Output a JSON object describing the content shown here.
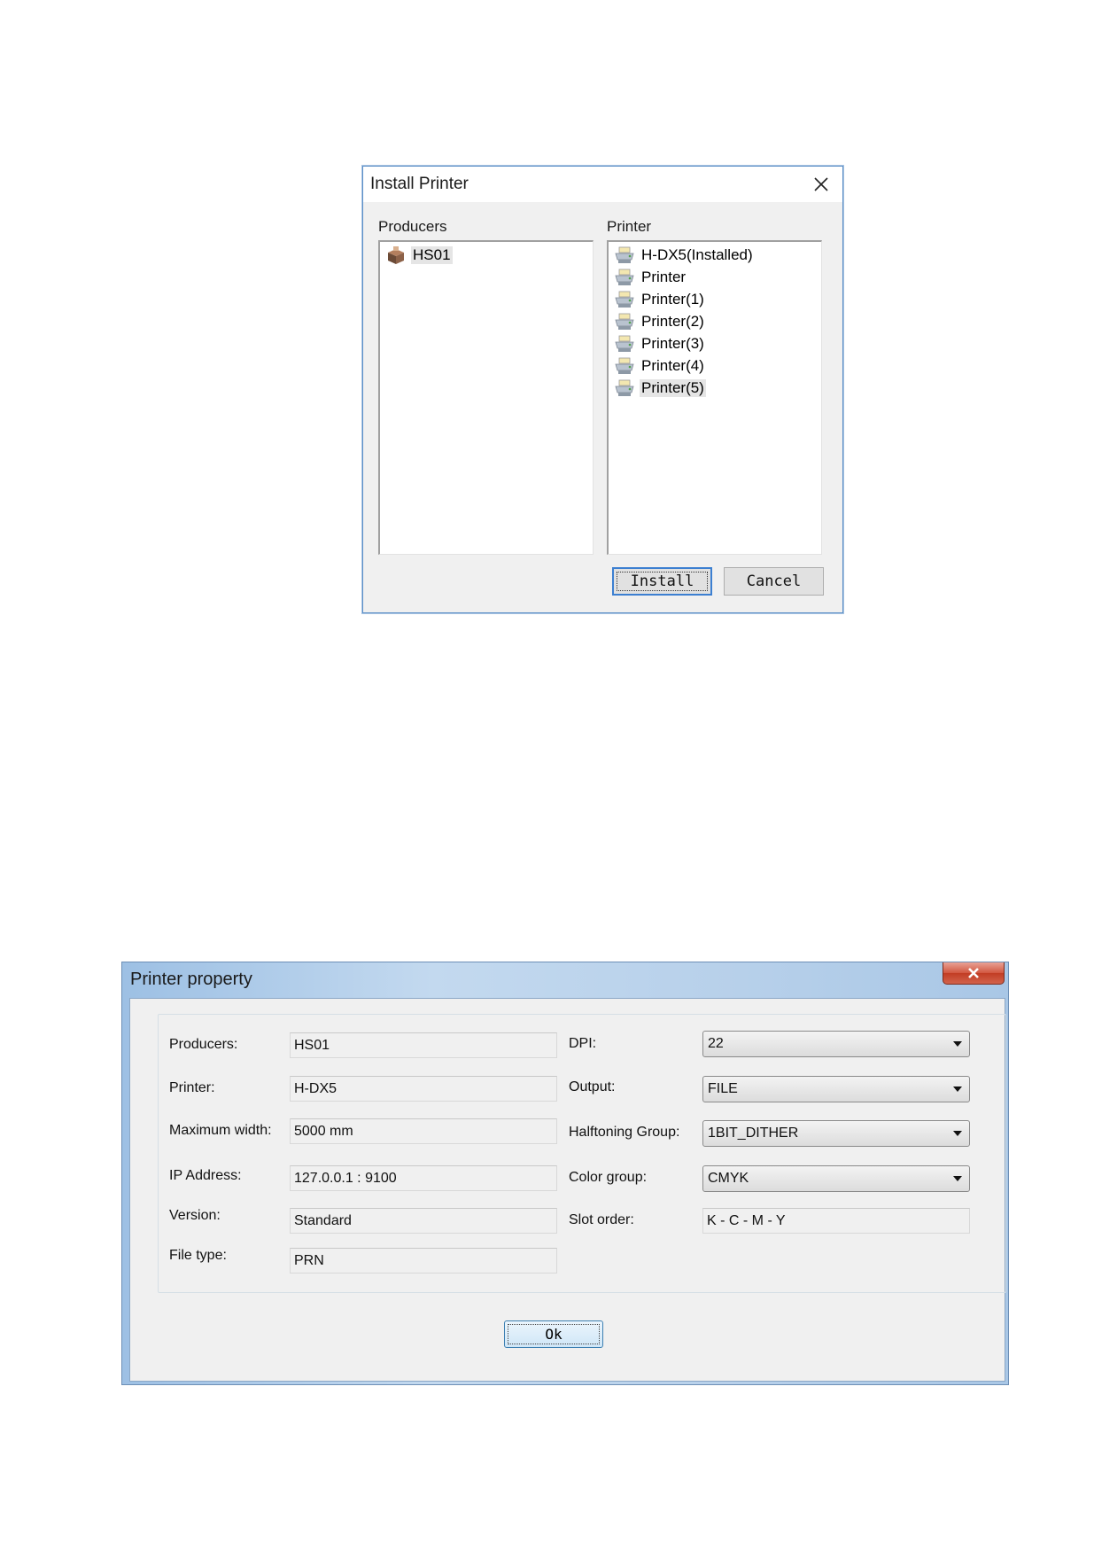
{
  "install_printer": {
    "title": "Install Printer",
    "producers_label": "Producers",
    "printer_label": "Printer",
    "producers": [
      {
        "name": "HS01",
        "icon": "producer-box-icon"
      }
    ],
    "printers": [
      {
        "name": "H-DX5(Installed)",
        "icon": "printer-icon"
      },
      {
        "name": "Printer",
        "icon": "printer-icon"
      },
      {
        "name": "Printer(1)",
        "icon": "printer-icon"
      },
      {
        "name": "Printer(2)",
        "icon": "printer-icon"
      },
      {
        "name": "Printer(3)",
        "icon": "printer-icon"
      },
      {
        "name": "Printer(4)",
        "icon": "printer-icon"
      },
      {
        "name": "Printer(5)",
        "icon": "printer-icon"
      }
    ],
    "install_label": "Install",
    "cancel_label": "Cancel"
  },
  "printer_property": {
    "title": "Printer property",
    "close_glyph": "X",
    "fields": {
      "producers": {
        "label": "Producers:",
        "value": "HS01"
      },
      "printer": {
        "label": "Printer:",
        "value": "H-DX5"
      },
      "maximum_width": {
        "label": "Maximum width:",
        "value": "5000 mm"
      },
      "ip_address": {
        "label": "IP Address:",
        "value": "127.0.0.1 : 9100"
      },
      "version": {
        "label": "Version:",
        "value": "Standard"
      },
      "file_type": {
        "label": "File type:",
        "value": "PRN"
      },
      "dpi": {
        "label": "DPI:",
        "value": "22"
      },
      "output": {
        "label": "Output:",
        "value": "FILE"
      },
      "halftoning_group": {
        "label": "Halftoning Group:",
        "value": "1BIT_DITHER"
      },
      "color_group": {
        "label": "Color group:",
        "value": "CMYK"
      },
      "slot_order": {
        "label": "Slot order:",
        "value": "K - C - M - Y"
      }
    },
    "ok_label": "Ok"
  }
}
